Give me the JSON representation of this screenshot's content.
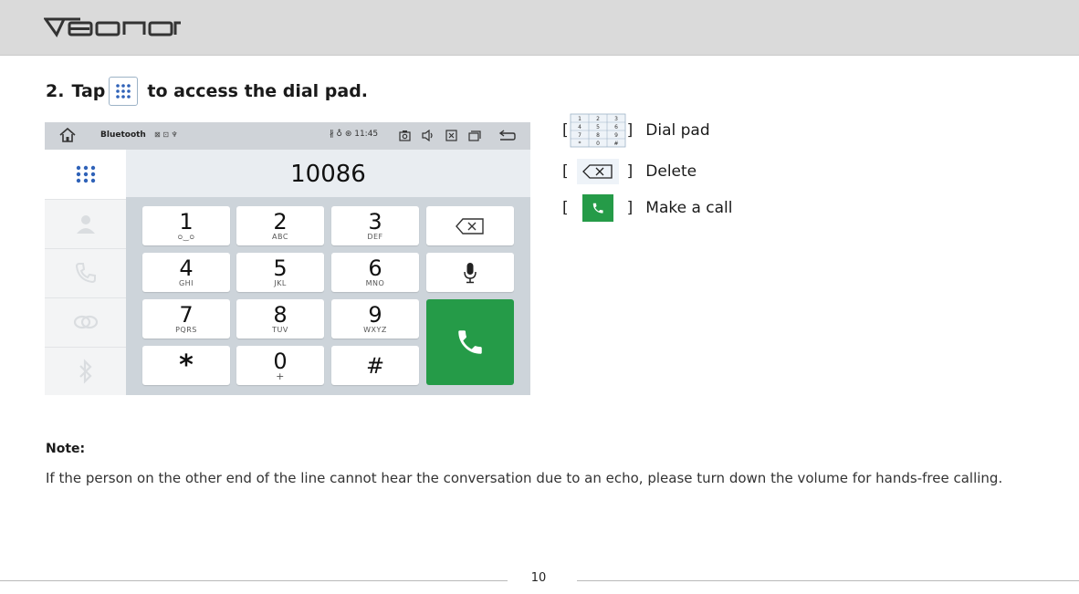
{
  "header": {
    "brand": "EONON"
  },
  "step": {
    "number": "2.",
    "before": "Tap",
    "after": "to access the dial pad."
  },
  "device": {
    "status": {
      "title": "Bluetooth",
      "mini_icons": "⊠ ⊡ ♆",
      "right_text": "∦ ♁ ⊛ 11:45"
    },
    "number_display": "10086",
    "sidebar_icons": [
      "dialpad-icon",
      "contacts-icon",
      "call-log-icon",
      "link-icon",
      "bluetooth-icon"
    ],
    "keys": [
      {
        "digit": "1",
        "letters": "ᴑ‿ᴑ"
      },
      {
        "digit": "2",
        "letters": "ABC"
      },
      {
        "digit": "3",
        "letters": "DEF"
      },
      {
        "digit": "4",
        "letters": "GHI"
      },
      {
        "digit": "5",
        "letters": "JKL"
      },
      {
        "digit": "6",
        "letters": "MNO"
      },
      {
        "digit": "7",
        "letters": "PQRS"
      },
      {
        "digit": "8",
        "letters": "TUV"
      },
      {
        "digit": "9",
        "letters": "WXYZ"
      },
      {
        "digit": "*",
        "letters": ""
      },
      {
        "digit": "0",
        "letters": "+"
      },
      {
        "digit": "#",
        "letters": ""
      }
    ],
    "colors": {
      "call_green": "#259b48",
      "sidebar_blue": "#2f62b8"
    }
  },
  "legend": [
    {
      "open": "[",
      "icon": "dial-pad-icon",
      "close": "]",
      "label": "Dial pad"
    },
    {
      "open": "[",
      "icon": "delete-icon",
      "close": "]",
      "label": "Delete"
    },
    {
      "open": "[",
      "icon": "call-icon",
      "close": "]",
      "label": "Make a call"
    }
  ],
  "note": {
    "title": "Note:",
    "text": "If the person on the other end of the line cannot hear the conversation due to an echo, please turn down the volume for hands-free calling."
  },
  "footer": {
    "page_number": "10"
  }
}
